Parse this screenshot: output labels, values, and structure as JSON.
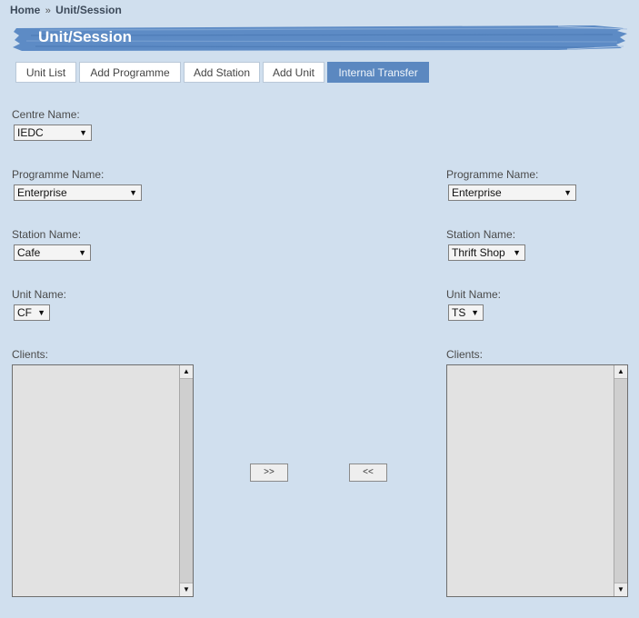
{
  "breadcrumb": {
    "home": "Home",
    "separator": "»",
    "current": "Unit/Session"
  },
  "page_title": "Unit/Session",
  "tabs": [
    {
      "label": "Unit List",
      "active": false
    },
    {
      "label": "Add Programme",
      "active": false
    },
    {
      "label": "Add Station",
      "active": false
    },
    {
      "label": "Add Unit",
      "active": false
    },
    {
      "label": "Internal Transfer",
      "active": true
    }
  ],
  "centre": {
    "label": "Centre Name:",
    "value": "IEDC"
  },
  "source": {
    "programme_label": "Programme Name:",
    "programme_value": "Enterprise",
    "station_label": "Station Name:",
    "station_value": "Cafe",
    "unit_label": "Unit Name:",
    "unit_value": "CF",
    "clients_label": "Clients:"
  },
  "target": {
    "programme_label": "Programme Name:",
    "programme_value": "Enterprise",
    "station_label": "Station Name:",
    "station_value": "Thrift Shop",
    "unit_label": "Unit Name:",
    "unit_value": "TS",
    "clients_label": "Clients:"
  },
  "buttons": {
    "move_right": ">>",
    "move_left": "<<"
  },
  "icons": {
    "dropdown": "▼",
    "scroll_up": "▲",
    "scroll_down": "▼"
  },
  "colors": {
    "background": "#d0dfee",
    "active_tab": "#5b88c0",
    "header_brush": "#5d8bc5"
  }
}
